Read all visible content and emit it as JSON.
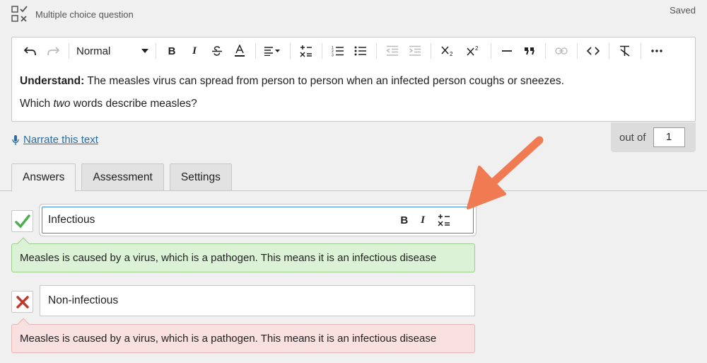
{
  "header": {
    "question_type_icon": "multiple-choice-icon",
    "question_type": "Multiple choice question",
    "status": "Saved"
  },
  "toolbar": {
    "format_value": "Normal",
    "icons": [
      "undo-icon",
      "redo-icon",
      "bold-icon",
      "italic-icon",
      "strikethrough-icon",
      "text-color-icon",
      "align-icon",
      "math-icon",
      "ordered-list-icon",
      "bullet-list-icon",
      "outdent-icon",
      "indent-icon",
      "subscript-icon",
      "superscript-icon",
      "horizontal-rule-icon",
      "blockquote-icon",
      "link-icon",
      "code-icon",
      "clear-format-icon",
      "more-icon"
    ]
  },
  "question": {
    "bold_prefix": "Understand:",
    "statement": " The measles virus can spread from person to person when an infected person coughs or sneezes.",
    "prompt_start": "Which ",
    "prompt_italic": "two",
    "prompt_end": " words describe measles?"
  },
  "narrate": {
    "label": "Narrate this text"
  },
  "score": {
    "label": "out of",
    "value": "1"
  },
  "tabs": [
    {
      "label": "Answers",
      "active": true
    },
    {
      "label": "Assessment",
      "active": false
    },
    {
      "label": "Settings",
      "active": false
    }
  ],
  "answers": [
    {
      "text": "Infectious",
      "correct": true,
      "feedback": "Measles is caused by a virus, which is a pathogen. This means it is an infectious disease"
    },
    {
      "text": "Non-infectious",
      "correct": false,
      "feedback": "Measles is caused by a virus, which is a pathogen. This means it is an infectious disease"
    }
  ],
  "colors": {
    "correct_mark": "#4caf50",
    "wrong_mark": "#c0392b",
    "annotation_arrow": "#f07a52",
    "link": "#2a6ea5",
    "focus_border": "#3c8dd0"
  }
}
